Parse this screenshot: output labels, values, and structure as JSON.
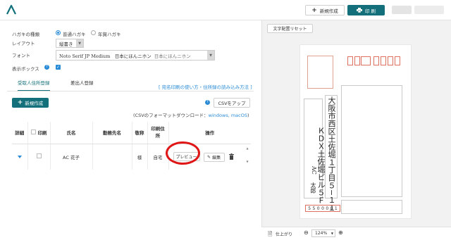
{
  "header": {
    "new_button": "新規作成",
    "print_button": "印 刷",
    "brand_color": "#13707a"
  },
  "form": {
    "card_type_label": "ハガキの種類",
    "card_type_options": [
      "普通ハガキ",
      "年賀ハガキ"
    ],
    "layout_label": "レイアウト",
    "layout_value": "縦書き",
    "font_label": "フォント",
    "font_value": "Noto Serif JP Medium　日本にほんニホン",
    "font_sample": "日本にほんニホン",
    "display_box_label": "表示ボックス"
  },
  "tabs": {
    "recipient": "受取人住所登録",
    "sender": "差出人登録"
  },
  "help_link": "[ 宛名印刷の使い方・住所録の読み込み方法 ]",
  "add_button": "新規作成",
  "csv_button": "CSVをアップ",
  "csv_note_prefix": "(CSVのフォーマットダウンロード：",
  "csv_links": "windows, macOS",
  "csv_note_suffix": ")",
  "table": {
    "headers": [
      "詳細",
      "印刷",
      "氏名",
      "勤務先名",
      "敬称",
      "印刷住所",
      "操作"
    ],
    "row": {
      "name": "AC 花子",
      "company": "",
      "honorific": "様",
      "print_address": "自宅",
      "preview_button": "プレビュー",
      "edit_button": "編集"
    }
  },
  "preview": {
    "reset_button": "文字配置リセット",
    "address_line1": "大阪市西区土佐堀１丁目５−１１",
    "address_line2": "ＫＤＸ土佐堀ビル５Ｆ",
    "name_company": "AC",
    "name_person": "太郎",
    "sender_zip": [
      "5",
      "5",
      "0",
      "0",
      "0",
      "0",
      "1"
    ]
  },
  "bottombar": {
    "finish_label": "仕上がり",
    "zoom": "124%"
  }
}
